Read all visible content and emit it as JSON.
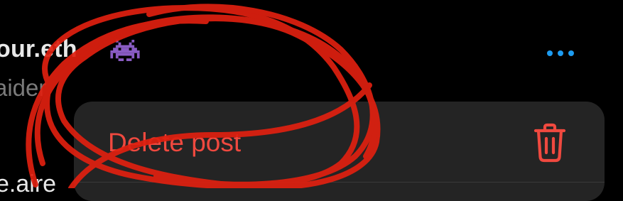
{
  "post": {
    "username": "our.eth",
    "subtitle": "aider",
    "body_text": "e.aire",
    "badge_icon": "space-invader-icon",
    "more_icon": "ellipsis-icon"
  },
  "menu": {
    "delete_label": "Delete post",
    "delete_icon": "trash-icon"
  },
  "colors": {
    "background": "#000000",
    "menu_background": "#242424",
    "destructive": "#f0493f",
    "accent": "#1d9bf0",
    "annotation": "#e02010"
  }
}
